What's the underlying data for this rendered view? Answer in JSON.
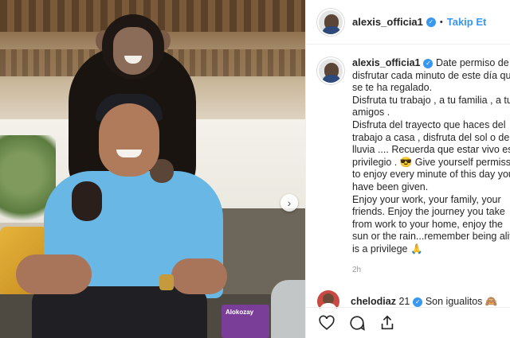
{
  "post": {
    "username": "alexis_officia1",
    "follow_label": "Takip Et",
    "separator": "•",
    "verified_mark": "✓",
    "caption_lines": [
      "Date permiso de",
      "disfrutar cada minuto de este día que",
      "se te ha regalado.",
      "Disfruta tu trabajo , a tu familia , a tus",
      "amigos .",
      "Disfruta del trayecto que haces del",
      "trabajo a casa , disfruta del sol o de la",
      "lluvia .... Recuerda que estar vivo es un",
      "privilegio . 😎 Give yourself permission",
      "to enjoy every minute of this day you",
      "have been given.",
      "Enjoy your work, your family, your",
      "friends. Enjoy the journey you take",
      "from work to your home, enjoy the",
      "sun or the rain...remember being alive",
      "is a privilege 🙏"
    ],
    "time_ago": "2h",
    "book_text": "Alokozay"
  },
  "comment": {
    "username": "chelodiaz",
    "number": "21",
    "text": "Son igualitos 🙈"
  },
  "actions": {
    "like_icon": "heart-icon",
    "comment_icon": "comment-icon",
    "share_icon": "share-icon"
  },
  "carousel": {
    "next_glyph": "›"
  },
  "colors": {
    "link": "#3897f0",
    "verified": "#3897f0",
    "text": "#262626",
    "muted": "#999999",
    "shirt": "#69b7e4"
  }
}
